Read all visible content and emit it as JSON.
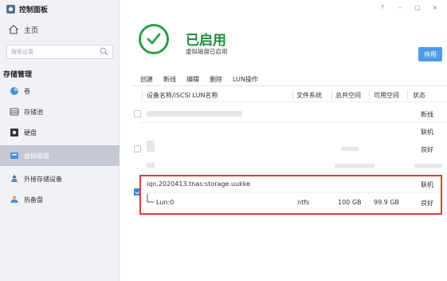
{
  "window": {
    "title": "控制面板",
    "controls": [
      "?",
      "–",
      "□",
      "×"
    ]
  },
  "sidebar": {
    "home": "主页",
    "search_placeholder": "搜索设置",
    "section": "存储管理",
    "items": [
      {
        "label": "卷",
        "icon": "volume-icon"
      },
      {
        "label": "存储池",
        "icon": "storage-pool-icon"
      },
      {
        "label": "硬盘",
        "icon": "disk-icon"
      },
      {
        "label": "虚拟磁盘",
        "icon": "virtual-disk-icon",
        "active": true
      },
      {
        "label": "外接存储设备",
        "icon": "external-storage-icon"
      },
      {
        "label": "热备盘",
        "icon": "hot-spare-icon"
      }
    ]
  },
  "status": {
    "title": "已启用",
    "subtitle": "虚拟磁盘已启用",
    "disable_button": "停用"
  },
  "toolbar": [
    "创建",
    "断线",
    "编辑",
    "删除",
    "LUN操作"
  ],
  "table": {
    "headers": [
      "设备名称/iSCSI LUN名称",
      "文件系统",
      "总共空间",
      "可用空间",
      "状态"
    ],
    "statuses": {
      "s1": "断线",
      "s2": "联机",
      "s3": "良好"
    },
    "selected": {
      "name": "iqn.2020413.tnas:storage.uukke",
      "status": "联机",
      "lun": {
        "name": "Lun:0",
        "filesystem": "ntfs",
        "total": "100 GB",
        "available": "99.9 GB",
        "status": "良好"
      }
    }
  },
  "colors": {
    "accent": "#4c9be8",
    "success": "#1f8a3c",
    "highlight": "#e03a3a",
    "active_nav": "#c4c9d2"
  }
}
